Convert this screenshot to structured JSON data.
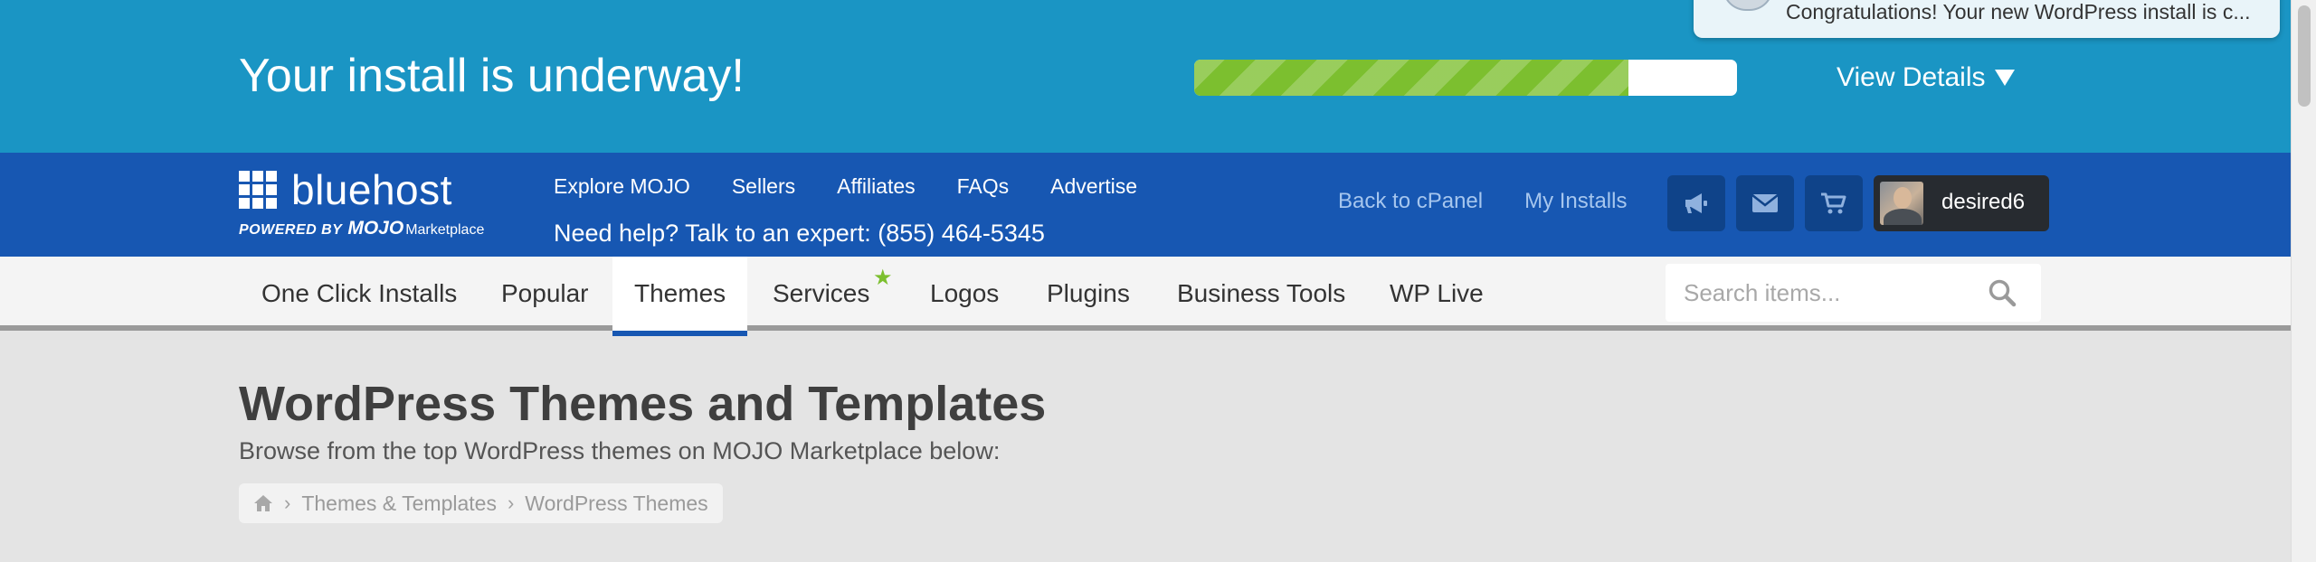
{
  "install_banner": {
    "title": "Your install is underway!",
    "progress": 0.8,
    "view_details_label": "View Details"
  },
  "notification": {
    "text": "Congratulations! Your new WordPress install is c..."
  },
  "header": {
    "logo": {
      "word": "bluehost",
      "powered_by": "POWERED BY",
      "mojo": "MOJO",
      "marketplace": "Marketplace"
    },
    "nav": [
      {
        "label": "Explore MOJO"
      },
      {
        "label": "Sellers"
      },
      {
        "label": "Affiliates"
      },
      {
        "label": "FAQs"
      },
      {
        "label": "Advertise"
      }
    ],
    "help_text": "Need help? Talk to an expert: (855) 464-5345",
    "right_links": [
      {
        "label": "Back to cPanel"
      },
      {
        "label": "My Installs"
      }
    ],
    "icon_buttons": [
      "megaphone-icon",
      "envelope-icon",
      "cart-icon"
    ],
    "username": "desired6"
  },
  "category_nav": {
    "items": [
      {
        "label": "One Click Installs"
      },
      {
        "label": "Popular"
      },
      {
        "label": "Themes",
        "active": true
      },
      {
        "label": "Services",
        "starred": true
      },
      {
        "label": "Logos"
      },
      {
        "label": "Plugins"
      },
      {
        "label": "Business Tools"
      },
      {
        "label": "WP Live"
      }
    ],
    "star_glyph": "★",
    "search_placeholder": "Search items..."
  },
  "page": {
    "title": "WordPress Themes and Templates",
    "subtitle": "Browse from the top WordPress themes on MOJO Marketplace below:",
    "breadcrumb": [
      "Themes & Templates",
      "WordPress Themes"
    ],
    "breadcrumb_separator": "›"
  },
  "colors": {
    "banner": "#1a95c4",
    "header": "#1757b2",
    "progress": "#7cbf2f",
    "accent_star": "#7cbf2f"
  }
}
